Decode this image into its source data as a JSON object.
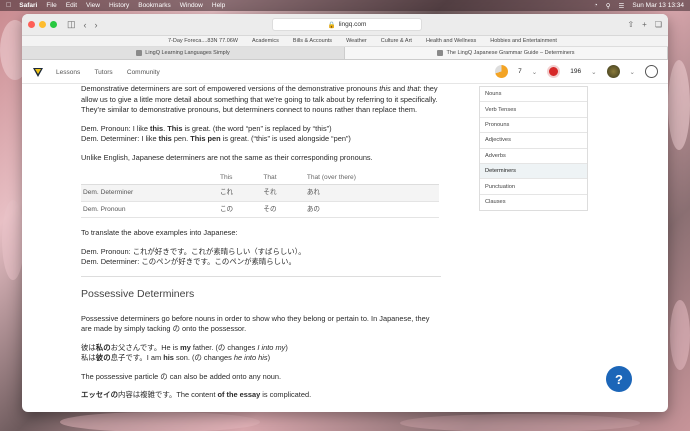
{
  "menubar": {
    "app": "Safari",
    "items": [
      "File",
      "Edit",
      "View",
      "History",
      "Bookmarks",
      "Window",
      "Help"
    ],
    "clock": "Sun Mar 13  13:34"
  },
  "browser": {
    "address": "lingq.com",
    "bookmarks": [
      "7-Day Foreca....83N 77.06W",
      "Academics",
      "Bills & Accounts",
      "Weather",
      "Culture & Art",
      "Health and Wellness",
      "Hobbies and Entertainment"
    ],
    "tabs": [
      {
        "label": "LingQ Learning Languages Simply",
        "active": false
      },
      {
        "label": "The LingQ Japanese Grammar Guide – Determiners",
        "active": true
      }
    ]
  },
  "site": {
    "nav": [
      "Lessons",
      "Tutors",
      "Community"
    ],
    "streak": "7",
    "coins": "196"
  },
  "sidemenu": {
    "items": [
      "Nouns",
      "Verb Tenses",
      "Pronouns",
      "Adjectives",
      "Adverbs",
      "Determiners",
      "Punctuation",
      "Clauses"
    ],
    "active": "Determiners"
  },
  "article": {
    "intro": "Demonstrative determiners are sort of empowered versions of the demonstrative pronouns ",
    "intro_this": "this",
    "intro_and": " and ",
    "intro_that": "that",
    "intro_rest": ": they allow us to give a little more detail about something that we’re going to talk about by referring to it specifically. They’re similar to demonstrative pronouns, but determiners connect to nouns rather than replace them.",
    "ex1_a": "Dem. Pronoun: I like ",
    "ex1_b": "this",
    "ex1_c": ". ",
    "ex1_d": "This",
    "ex1_e": " is great. (the word “pen” is replaced by “this”)",
    "ex2_a": "Dem. Determiner: I like ",
    "ex2_b": "this",
    "ex2_c": " pen. ",
    "ex2_d": "This pen",
    "ex2_e": " is great. (“this” is used alongside “pen”)",
    "unlike": "Unlike English, Japanese determiners are not the same as their corresponding pronouns.",
    "table": {
      "headers": [
        "",
        "This",
        "That",
        "That (over there)"
      ],
      "rows": [
        [
          "Dem. Determiner",
          "これ",
          "それ",
          "あれ"
        ],
        [
          "Dem. Pronoun",
          "この",
          "その",
          "あの"
        ]
      ]
    },
    "translate": "To translate the above examples into Japanese:",
    "jp1": "Dem. Pronoun: これが好きです。これが素晴らしい（すばらしい）。",
    "jp2": "Dem. Determiner: このペンが好きです。このペンが素晴らしい。",
    "heading2": "Possessive Determiners",
    "poss": "Possessive determiners go before nouns in order to show who they belong or pertain to. In Japanese, they are made by simply tacking の onto the possessor.",
    "p1_a": "彼は",
    "p1_b": "私の",
    "p1_c": "お父さんです。He is ",
    "p1_d": "my",
    "p1_e": " father. (の changes ",
    "p1_f": "I into my",
    "p1_g": ")",
    "p2_a": "私は",
    "p2_b": "彼の",
    "p2_c": "息子です。I am ",
    "p2_d": "his",
    "p2_e": " son. (の changes ",
    "p2_f": "he into his",
    "p2_g": ")",
    "particle": "The possessive particle の can also be added onto any noun.",
    "essay_a": "エッセイの",
    "essay_b": "内容は複雑です。The content ",
    "essay_c": "of the essay",
    "essay_d": " is complicated."
  },
  "help": "?"
}
